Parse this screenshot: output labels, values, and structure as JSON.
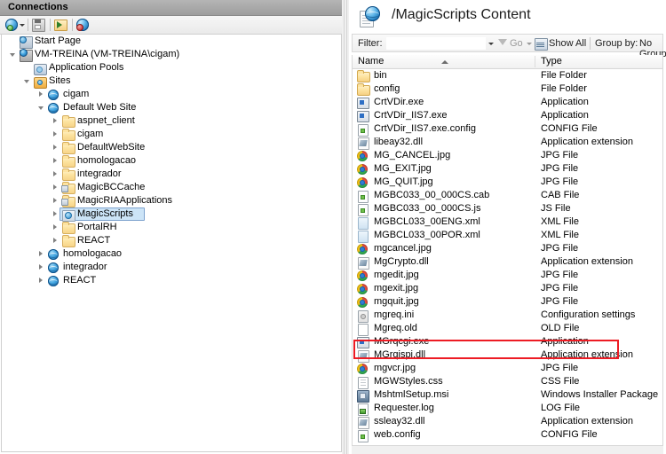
{
  "left_pane": {
    "header_title": "Connections",
    "toolbar": [
      {
        "name": "connect-to-server",
        "icon": "globe-dropdown-icon",
        "label": "Connect"
      },
      {
        "name": "save-connections",
        "icon": "save-disk-icon",
        "label": "Save"
      },
      {
        "name": "connect-to-site",
        "icon": "folder-connect-icon",
        "label": "Connect to a Site"
      },
      {
        "name": "disconnect",
        "icon": "globe-disconnect-icon",
        "label": "Disconnect"
      }
    ],
    "tree": [
      {
        "label": "Start Page",
        "icon": "start-page-icon",
        "indent": 0,
        "arrow": "none",
        "selected": false
      },
      {
        "label": "VM-TREINA (VM-TREINA\\cigam)",
        "icon": "server-icon",
        "indent": 0,
        "arrow": "expanded",
        "selected": false
      },
      {
        "label": "Application Pools",
        "icon": "application-pools-icon",
        "indent": 1,
        "arrow": "none",
        "selected": false
      },
      {
        "label": "Sites",
        "icon": "sites-folder-icon",
        "indent": 1,
        "arrow": "expanded",
        "selected": false
      },
      {
        "label": "cigam",
        "icon": "website-globe-icon",
        "indent": 2,
        "arrow": "collapsed",
        "selected": false
      },
      {
        "label": "Default Web Site",
        "icon": "website-globe-icon",
        "indent": 2,
        "arrow": "expanded",
        "selected": false
      },
      {
        "label": "aspnet_client",
        "icon": "folder-icon",
        "indent": 3,
        "arrow": "collapsed",
        "selected": false
      },
      {
        "label": "cigam",
        "icon": "folder-icon",
        "indent": 3,
        "arrow": "collapsed",
        "selected": false
      },
      {
        "label": "DefaultWebSite",
        "icon": "folder-icon",
        "indent": 3,
        "arrow": "collapsed",
        "selected": false
      },
      {
        "label": "homologacao",
        "icon": "folder-icon",
        "indent": 3,
        "arrow": "collapsed",
        "selected": false
      },
      {
        "label": "integrador",
        "icon": "folder-icon",
        "indent": 3,
        "arrow": "collapsed",
        "selected": false
      },
      {
        "label": "MagicBCCache",
        "icon": "application-folder-icon",
        "indent": 3,
        "arrow": "collapsed",
        "selected": false
      },
      {
        "label": "MagicRIAApplications",
        "icon": "application-folder-icon",
        "indent": 3,
        "arrow": "collapsed",
        "selected": false
      },
      {
        "label": "MagicScripts",
        "icon": "virtual-directory-icon",
        "indent": 3,
        "arrow": "collapsed",
        "selected": true
      },
      {
        "label": "PortalRH",
        "icon": "folder-icon",
        "indent": 3,
        "arrow": "collapsed",
        "selected": false
      },
      {
        "label": "REACT",
        "icon": "folder-icon",
        "indent": 3,
        "arrow": "collapsed",
        "selected": false
      },
      {
        "label": "homologacao",
        "icon": "website-globe-icon",
        "indent": 2,
        "arrow": "collapsed",
        "selected": false
      },
      {
        "label": "integrador",
        "icon": "website-globe-icon",
        "indent": 2,
        "arrow": "collapsed",
        "selected": false
      },
      {
        "label": "REACT",
        "icon": "website-globe-icon",
        "indent": 2,
        "arrow": "collapsed",
        "selected": false
      }
    ]
  },
  "right_pane": {
    "page_title": "/MagicScripts Content",
    "title_icon": "content-view-icon",
    "filter_bar": {
      "filter_label": "Filter:",
      "filter_value": "",
      "filter_placeholder": "",
      "go_label": "Go",
      "show_all_label": "Show All",
      "group_by_label": "Group by:",
      "group_by_value": "No Grouping"
    },
    "grid": {
      "columns": [
        "Name",
        "Type"
      ],
      "sort_column": "Name",
      "sort_direction": "ascending",
      "rows": [
        {
          "name": "bin",
          "type": "File Folder",
          "icon": "folder-icon"
        },
        {
          "name": "config",
          "type": "File Folder",
          "icon": "folder-icon"
        },
        {
          "name": "CrtVDir.exe",
          "type": "Application",
          "icon": "exe-icon"
        },
        {
          "name": "CrtVDir_IIS7.exe",
          "type": "Application",
          "icon": "exe-icon"
        },
        {
          "name": "CrtVDir_IIS7.exe.config",
          "type": "CONFIG File",
          "icon": "config-icon"
        },
        {
          "name": "libeay32.dll",
          "type": "Application extension",
          "icon": "dll-icon"
        },
        {
          "name": "MG_CANCEL.jpg",
          "type": "JPG File",
          "icon": "jpg-icon"
        },
        {
          "name": "MG_EXIT.jpg",
          "type": "JPG File",
          "icon": "jpg-icon"
        },
        {
          "name": "MG_QUIT.jpg",
          "type": "JPG File",
          "icon": "jpg-icon"
        },
        {
          "name": "MGBC033_00_000CS.cab",
          "type": "CAB File",
          "icon": "cab-icon"
        },
        {
          "name": "MGBC033_00_000CS.js",
          "type": "JS File",
          "icon": "js-icon"
        },
        {
          "name": "MGBCL033_00ENG.xml",
          "type": "XML File",
          "icon": "xml-icon"
        },
        {
          "name": "MGBCL033_00POR.xml",
          "type": "XML File",
          "icon": "xml-icon"
        },
        {
          "name": "mgcancel.jpg",
          "type": "JPG File",
          "icon": "jpg-icon"
        },
        {
          "name": "MgCrypto.dll",
          "type": "Application extension",
          "icon": "dll-icon"
        },
        {
          "name": "mgedit.jpg",
          "type": "JPG File",
          "icon": "jpg-icon"
        },
        {
          "name": "mgexit.jpg",
          "type": "JPG File",
          "icon": "jpg-icon"
        },
        {
          "name": "mgquit.jpg",
          "type": "JPG File",
          "icon": "jpg-icon"
        },
        {
          "name": "mgreq.ini",
          "type": "Configuration settings",
          "icon": "ini-icon"
        },
        {
          "name": "Mgreq.old",
          "type": "OLD File",
          "icon": "old-icon"
        },
        {
          "name": "MGrqcgi.exe",
          "type": "Application",
          "icon": "exe-icon"
        },
        {
          "name": "MGrqispi.dll",
          "type": "Application extension",
          "icon": "dll-icon"
        },
        {
          "name": "mgvcr.jpg",
          "type": "JPG File",
          "icon": "jpg-icon"
        },
        {
          "name": "MGWStyles.css",
          "type": "CSS File",
          "icon": "css-icon"
        },
        {
          "name": "MshtmlSetup.msi",
          "type": "Windows Installer Package",
          "icon": "msi-icon"
        },
        {
          "name": "Requester.log",
          "type": "LOG File",
          "icon": "log-icon"
        },
        {
          "name": "ssleay32.dll",
          "type": "Application extension",
          "icon": "dll-icon"
        },
        {
          "name": "web.config",
          "type": "CONFIG File",
          "icon": "config-icon"
        }
      ]
    }
  },
  "annotation": {
    "highlight_row_name": "MGrqispi.dll",
    "highlight_color": "#ed1c24"
  }
}
